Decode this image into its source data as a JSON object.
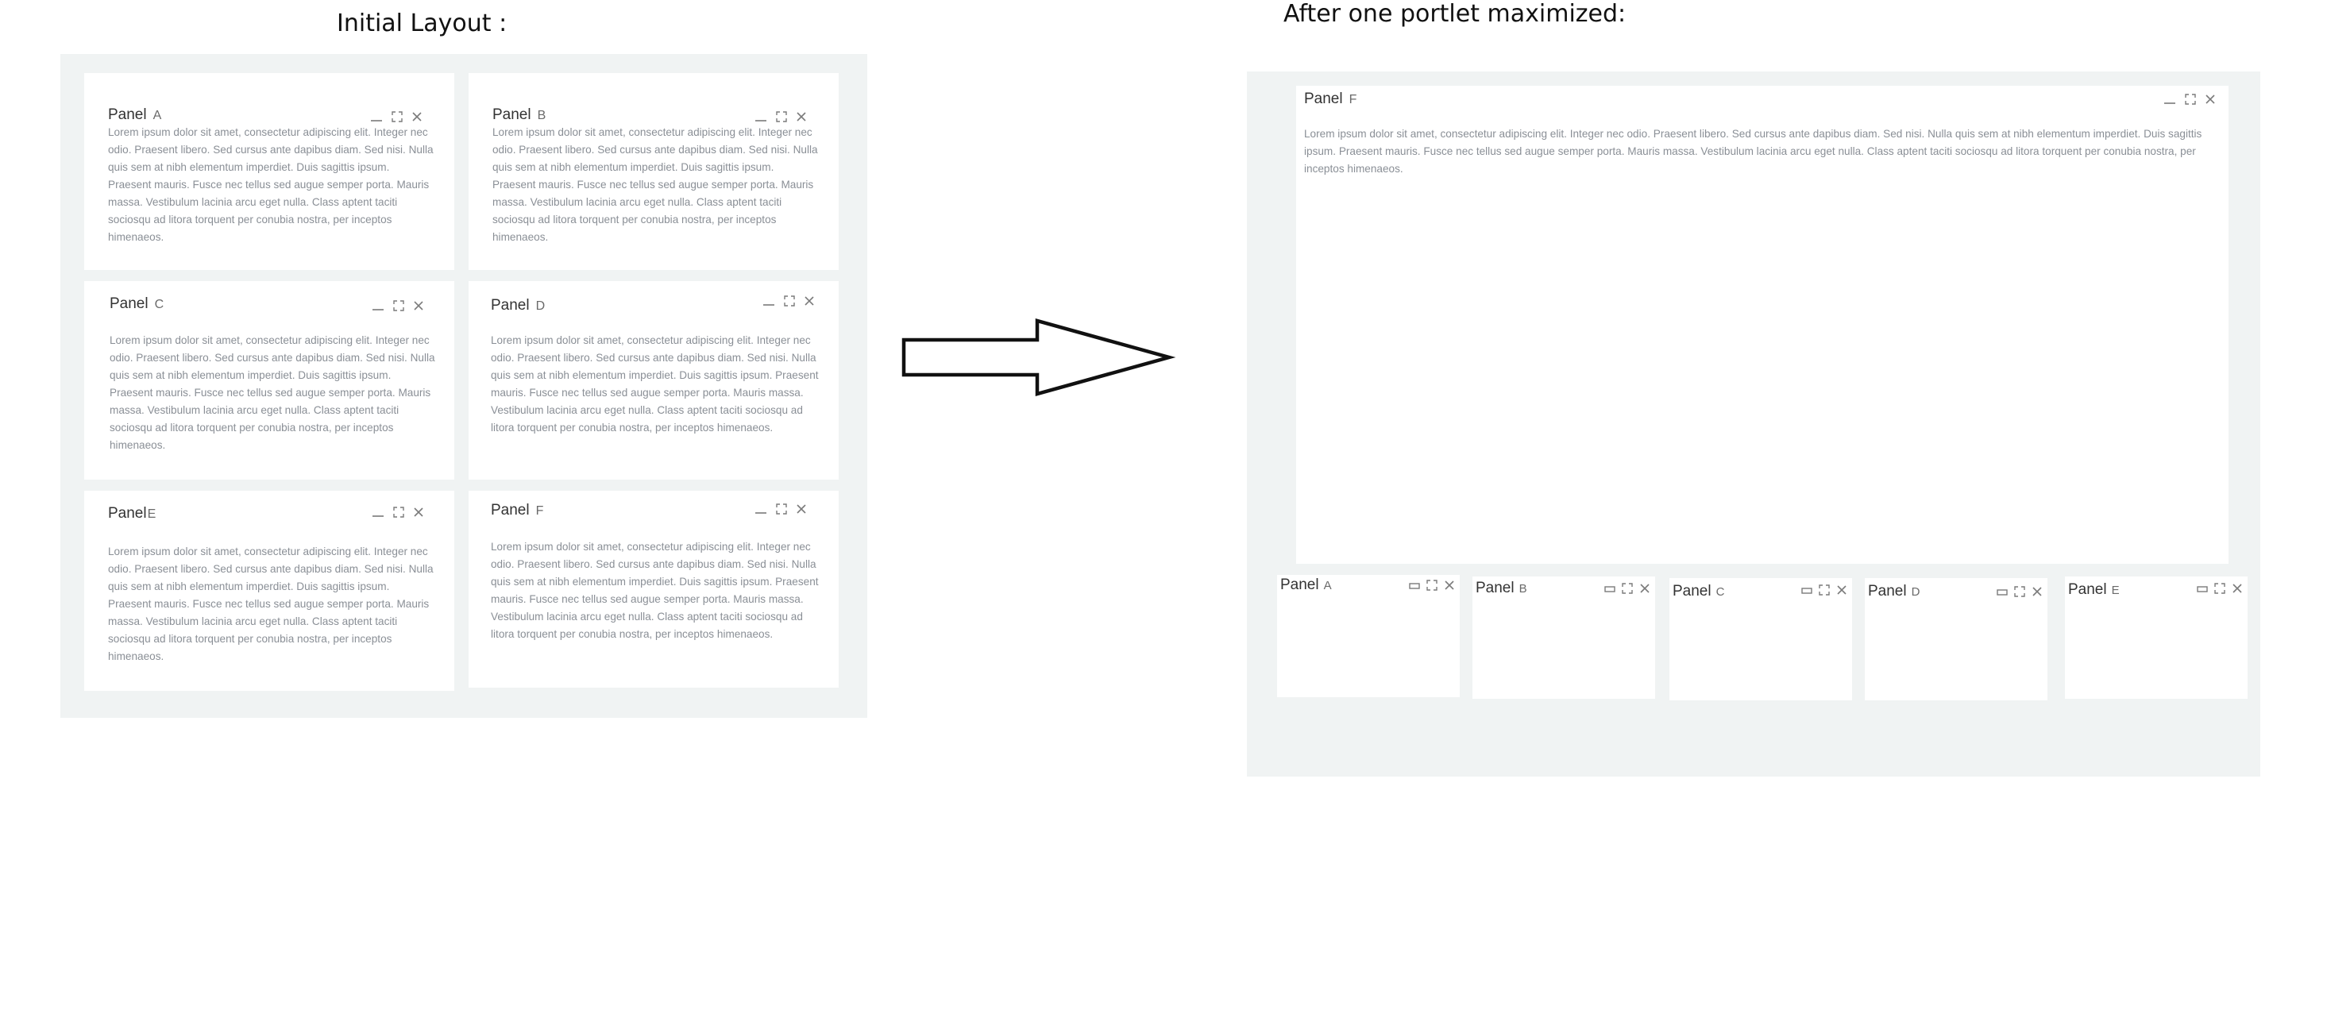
{
  "captions": {
    "initial": "Initial Layout :",
    "after": "After one portlet maximized:"
  },
  "panel_word": "Panel",
  "lorem": "Lorem ipsum dolor sit amet, consectetur adipiscing elit. Integer nec odio. Praesent libero. Sed cursus ante dapibus diam. Sed nisi. Nulla quis sem at nibh elementum imperdiet. Duis sagittis ipsum. Praesent mauris. Fusce nec tellus sed augue semper porta. Mauris massa. Vestibulum lacinia arcu eget nulla. Class aptent taciti sociosqu ad litora torquent per conubia nostra, per inceptos himenaeos.",
  "initial_panels": [
    {
      "letter": "A"
    },
    {
      "letter": "B"
    },
    {
      "letter": "C"
    },
    {
      "letter": "D"
    },
    {
      "letter": "E"
    },
    {
      "letter": "F"
    }
  ],
  "maximized_panel": {
    "letter": "F"
  },
  "minimized_panels": [
    {
      "letter": "A"
    },
    {
      "letter": "B"
    },
    {
      "letter": "C"
    },
    {
      "letter": "D"
    },
    {
      "letter": "E"
    }
  ],
  "icons": {
    "initial_controls": [
      "minimize-icon",
      "maximize-icon",
      "close-icon"
    ],
    "minimized_controls": [
      "restore-icon",
      "maximize-icon",
      "close-icon"
    ],
    "arrow": "right-arrow-icon"
  },
  "colors": {
    "board_background": "#f0f3f3",
    "panel_background": "#ffffff",
    "body_text": "#8a8f96",
    "icon": "#7a7a7a"
  }
}
